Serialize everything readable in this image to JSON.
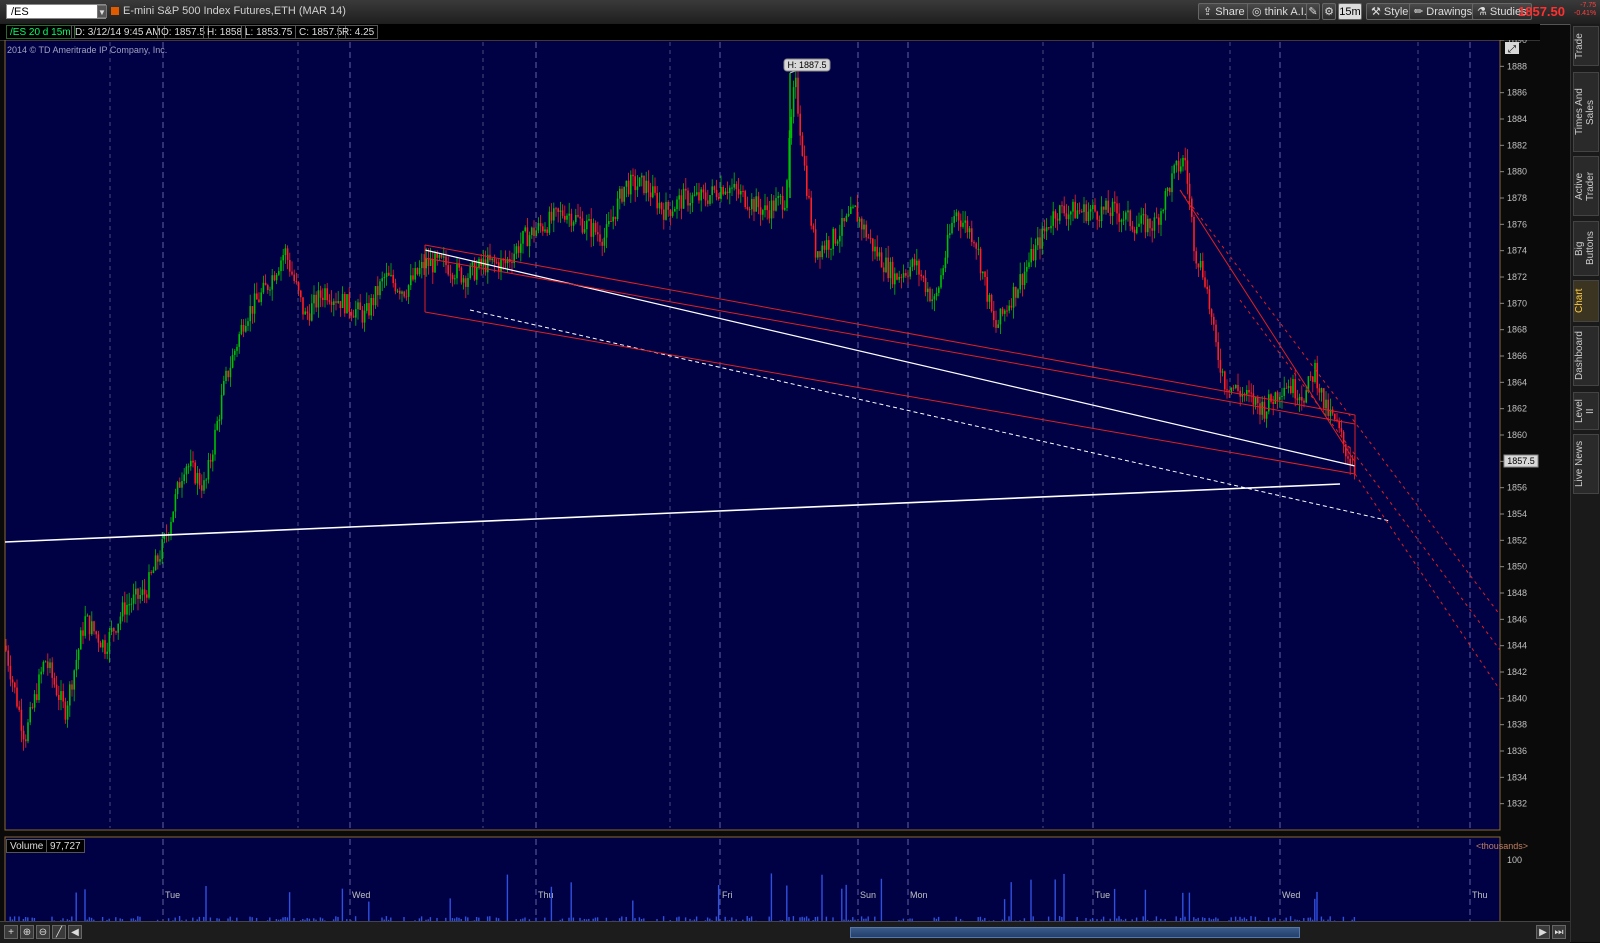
{
  "topbar": {
    "symbol": "/ES",
    "title": "E-mini S&P 500 Index Futures,ETH (MAR 14)",
    "share": "Share",
    "think": "think A.I.",
    "aggregation": "15m",
    "style": "Style",
    "drawings": "Drawings",
    "studies": "Studies",
    "last_price": "1857.50",
    "change_top": "-7.75",
    "change_bottom": "-0.41%"
  },
  "info": {
    "label": "/ES 20 d 15m",
    "date": "D: 3/12/14 9:45 AM",
    "open": "O: 1857.5",
    "high": "H: 1858",
    "low": "L: 1853.75",
    "close": "C: 1857.5",
    "range": "R: 4.25"
  },
  "chart": {
    "copyright": "2014 © TD Ameritrade IP Company, Inc.",
    "high_marker": "H: 1887.5",
    "price_marker": "1857.5",
    "volume_label": "Volume",
    "volume_value": "97,727",
    "volume_units": "<thousands>",
    "volume_tick": "100",
    "colors": {
      "background": "#000040",
      "up": "#00c000",
      "down": "#ff2020",
      "grid": "#6060a0",
      "trend_red": "#e02020",
      "trend_white": "#ffffff",
      "volume": "#3050e0"
    }
  },
  "chart_data": {
    "type": "candlestick",
    "title": "E-mini S&P 500 Index Futures,ETH (MAR 14)",
    "ylim": [
      1830,
      1890
    ],
    "yticks": [
      1832,
      1834,
      1836,
      1838,
      1840,
      1842,
      1844,
      1846,
      1848,
      1850,
      1852,
      1854,
      1856,
      1858,
      1860,
      1862,
      1864,
      1866,
      1868,
      1870,
      1872,
      1874,
      1876,
      1878,
      1880,
      1882,
      1884,
      1886,
      1888,
      1890
    ],
    "day_labels": [
      "Tue",
      "Wed",
      "Thu",
      "Fri",
      "Sun",
      "Mon",
      "Tue",
      "Wed",
      "Thu"
    ],
    "price_path": [
      [
        0,
        1844
      ],
      [
        20,
        1837
      ],
      [
        40,
        1843
      ],
      [
        60,
        1839
      ],
      [
        80,
        1846
      ],
      [
        100,
        1844
      ],
      [
        120,
        1847
      ],
      [
        140,
        1848
      ],
      [
        160,
        1852
      ],
      [
        180,
        1858
      ],
      [
        200,
        1856
      ],
      [
        220,
        1864
      ],
      [
        240,
        1869
      ],
      [
        260,
        1871
      ],
      [
        280,
        1874
      ],
      [
        300,
        1869
      ],
      [
        320,
        1871
      ],
      [
        340,
        1870
      ],
      [
        360,
        1869
      ],
      [
        380,
        1872
      ],
      [
        400,
        1871
      ],
      [
        420,
        1873
      ],
      [
        440,
        1873
      ],
      [
        460,
        1872
      ],
      [
        480,
        1873
      ],
      [
        500,
        1873
      ],
      [
        520,
        1875
      ],
      [
        540,
        1876
      ],
      [
        560,
        1877
      ],
      [
        580,
        1876
      ],
      [
        600,
        1875
      ],
      [
        620,
        1879
      ],
      [
        640,
        1879
      ],
      [
        660,
        1877
      ],
      [
        680,
        1878
      ],
      [
        700,
        1878
      ],
      [
        720,
        1879
      ],
      [
        740,
        1878
      ],
      [
        760,
        1877
      ],
      [
        780,
        1878
      ],
      [
        790,
        1887
      ],
      [
        800,
        1880
      ],
      [
        810,
        1874
      ],
      [
        830,
        1875
      ],
      [
        850,
        1877
      ],
      [
        870,
        1874
      ],
      [
        890,
        1872
      ],
      [
        910,
        1873
      ],
      [
        930,
        1870
      ],
      [
        950,
        1877
      ],
      [
        970,
        1875
      ],
      [
        990,
        1868
      ],
      [
        1010,
        1871
      ],
      [
        1030,
        1874
      ],
      [
        1050,
        1877
      ],
      [
        1070,
        1877
      ],
      [
        1090,
        1877
      ],
      [
        1110,
        1877
      ],
      [
        1130,
        1876
      ],
      [
        1150,
        1876
      ],
      [
        1170,
        1880
      ],
      [
        1180,
        1881
      ],
      [
        1190,
        1874
      ],
      [
        1200,
        1872
      ],
      [
        1210,
        1867
      ],
      [
        1220,
        1864
      ],
      [
        1240,
        1863
      ],
      [
        1260,
        1862
      ],
      [
        1280,
        1864
      ],
      [
        1300,
        1863
      ],
      [
        1310,
        1865
      ],
      [
        1320,
        1862
      ],
      [
        1330,
        1861
      ],
      [
        1340,
        1859
      ],
      [
        1350,
        1857.5
      ]
    ],
    "high": 1887.5,
    "last": 1857.5
  },
  "right_tabs": [
    "Trade",
    "Times And Sales",
    "Active Trader",
    "Big Buttons",
    "Chart",
    "Dashboard",
    "Level II",
    "Live News"
  ]
}
